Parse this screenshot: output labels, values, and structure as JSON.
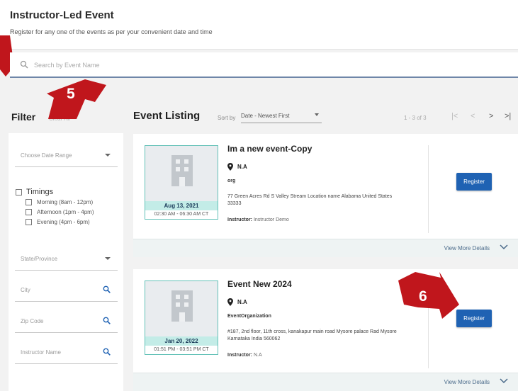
{
  "header": {
    "title": "Instructor-Led Event",
    "subtitle": "Register for any one of the events as per your convenient date and time"
  },
  "search": {
    "placeholder": "Search by Event Name"
  },
  "filter": {
    "title": "Filter",
    "clear_label": "Clear All",
    "date_range_placeholder": "Choose Date Range",
    "timings_label": "Timings",
    "timing_options": [
      "Morning (8am - 12pm)",
      "Afternoon (1pm - 4pm)",
      "Evening (4pm - 6pm)"
    ],
    "state_placeholder": "State/Province",
    "city_placeholder": "City",
    "zip_placeholder": "Zip Code",
    "instructor_placeholder": "Instructor Name"
  },
  "listing": {
    "title": "Event Listing",
    "sort_label": "Sort by",
    "sort_value": "Date - Newest First",
    "page_count": "1 - 3 of 3",
    "pager": {
      "first": "|<",
      "prev": "<",
      "next": ">",
      "last": ">|"
    }
  },
  "events": [
    {
      "name": "Im a new event-Copy",
      "location": "N.A",
      "organization": "org",
      "address": "77 Green Acres Rd S Valley Stream Location name Alabama United States 33333",
      "instructor_label": "Instructor:",
      "instructor": "Instructor Demo",
      "date": "Aug 13, 2021",
      "time": "02:30 AM - 06:30 AM CT",
      "register_label": "Register",
      "view_more_label": "View More Details"
    },
    {
      "name": "Event New 2024",
      "location": "N.A",
      "organization": "EventOrganization",
      "address": "#187, 2nd floor, 11th cross, kanakapur main road Mysore palace Rad Mysore Karnataka India 560062",
      "instructor_label": "Instructor:",
      "instructor": "N.A",
      "date": "Jan 20, 2022",
      "time": "01:51 PM - 03:51 PM CT",
      "register_label": "Register",
      "view_more_label": "View More Details"
    }
  ],
  "callouts": {
    "filter_step": "5",
    "register_step": "6"
  },
  "colors": {
    "accent": "#1f62b3",
    "callout": "#c0161c",
    "teal": "#62c1b7",
    "date_band": "#c3ece7"
  },
  "icons": [
    "search-icon",
    "caret-down-icon",
    "magnifier-icon",
    "building-icon",
    "map-pin-icon",
    "chevron-down-icon"
  ]
}
